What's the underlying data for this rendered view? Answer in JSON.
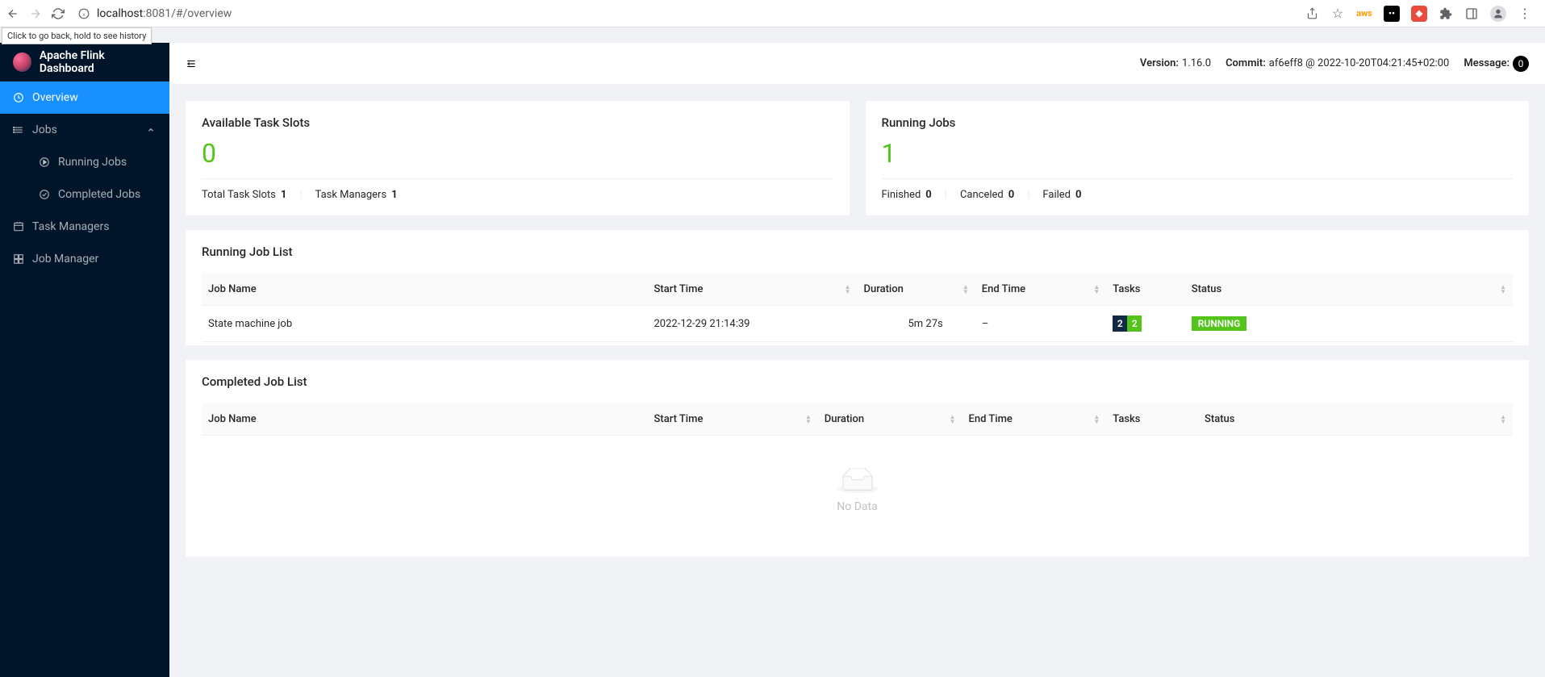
{
  "browser": {
    "url_host": "localhost",
    "url_rest": ":8081/#/overview",
    "back_tooltip": "Click to go back, hold to see history"
  },
  "sidebar": {
    "brand": "Apache Flink Dashboard",
    "items": {
      "overview": "Overview",
      "jobs": "Jobs",
      "running_jobs": "Running Jobs",
      "completed_jobs": "Completed Jobs",
      "task_managers": "Task Managers",
      "job_manager": "Job Manager"
    }
  },
  "topbar": {
    "version_label": "Version:",
    "version_value": "1.16.0",
    "commit_label": "Commit:",
    "commit_value": "af6eff8 @ 2022-10-20T04:21:45+02:00",
    "message_label": "Message:",
    "message_badge": "0"
  },
  "cards": {
    "slots": {
      "title": "Available Task Slots",
      "value": "0",
      "total_label": "Total Task Slots",
      "total_value": "1",
      "tm_label": "Task Managers",
      "tm_value": "1"
    },
    "running": {
      "title": "Running Jobs",
      "value": "1",
      "finished_label": "Finished",
      "finished_value": "0",
      "canceled_label": "Canceled",
      "canceled_value": "0",
      "failed_label": "Failed",
      "failed_value": "0"
    }
  },
  "running_jobs": {
    "title": "Running Job List",
    "columns": {
      "name": "Job Name",
      "start": "Start Time",
      "duration": "Duration",
      "end": "End Time",
      "tasks": "Tasks",
      "status": "Status"
    },
    "rows": [
      {
        "name": "State machine job",
        "start": "2022-12-29 21:14:39",
        "duration": "5m 27s",
        "end": "–",
        "task_a": "2",
        "task_b": "2",
        "status": "RUNNING"
      }
    ]
  },
  "completed_jobs": {
    "title": "Completed Job List",
    "columns": {
      "name": "Job Name",
      "start": "Start Time",
      "duration": "Duration",
      "end": "End Time",
      "tasks": "Tasks",
      "status": "Status"
    },
    "empty": "No Data"
  }
}
